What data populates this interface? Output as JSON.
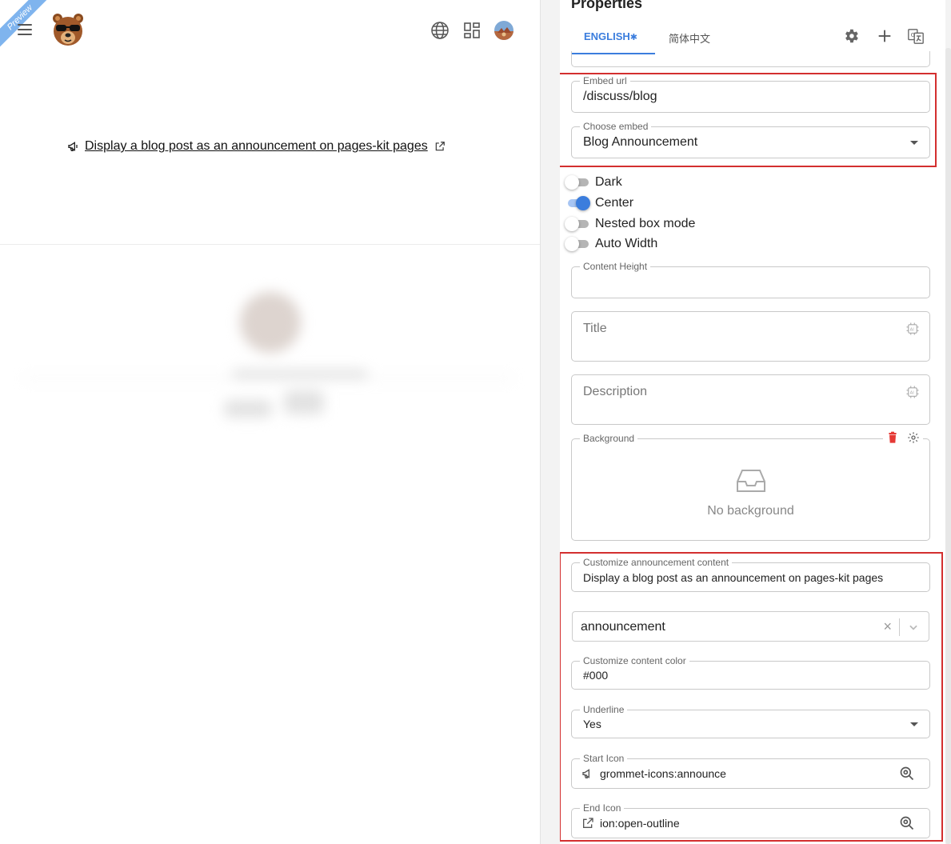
{
  "preview": {
    "ribbon_label": "Preview",
    "announcement_text": "Display a blog post as an announcement on pages-kit pages",
    "icons": [
      "menu-icon",
      "bear-logo",
      "globe-icon",
      "apps-grid-icon",
      "user-avatar",
      "megaphone-icon",
      "external-link-icon"
    ]
  },
  "properties": {
    "title": "Properties",
    "tabs": [
      {
        "label": "ENGLISH",
        "active": true,
        "marker": "✱"
      },
      {
        "label": "简体中文",
        "active": false
      }
    ],
    "embed_url": {
      "label": "Embed url",
      "value": "/discuss/blog"
    },
    "choose_embed": {
      "label": "Choose embed",
      "value": "Blog Announcement"
    },
    "switches": [
      {
        "label": "Dark",
        "on": false
      },
      {
        "label": "Center",
        "on": true
      },
      {
        "label": "Nested box mode",
        "on": false
      },
      {
        "label": "Auto Width",
        "on": false
      }
    ],
    "content_height": {
      "label": "Content Height",
      "value": ""
    },
    "title_field": {
      "placeholder": "Title"
    },
    "description_field": {
      "placeholder": "Description"
    },
    "background": {
      "label": "Background",
      "empty_text": "No background"
    },
    "customize_content": {
      "label": "Customize announcement content",
      "value": "Display a blog post as an announcement on pages-kit pages"
    },
    "category_select": {
      "value": "announcement",
      "clear": "×"
    },
    "content_color": {
      "label": "Customize content color",
      "value": "#000"
    },
    "underline": {
      "label": "Underline",
      "value": "Yes"
    },
    "start_icon": {
      "label": "Start Icon",
      "value": "grommet-icons:announce"
    },
    "end_icon": {
      "label": "End Icon",
      "value": "ion:open-outline"
    }
  },
  "colors": {
    "accent": "#3b7ddd",
    "highlight": "#d32f2f",
    "delete": "#e53935"
  }
}
